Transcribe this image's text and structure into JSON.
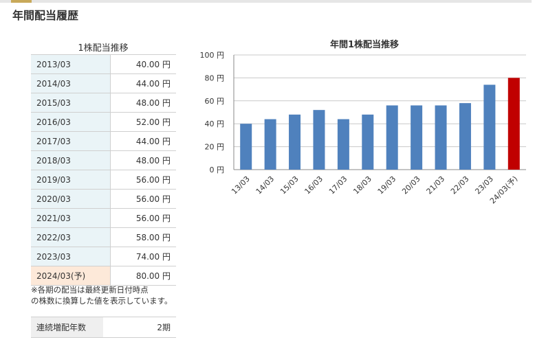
{
  "section_title": "年間配当履歴",
  "table": {
    "caption": "1株配当推移",
    "rows": [
      {
        "year": "2013/03",
        "value": "40.00 円"
      },
      {
        "year": "2014/03",
        "value": "44.00 円"
      },
      {
        "year": "2015/03",
        "value": "48.00 円"
      },
      {
        "year": "2016/03",
        "value": "52.00 円"
      },
      {
        "year": "2017/03",
        "value": "44.00 円"
      },
      {
        "year": "2018/03",
        "value": "48.00 円"
      },
      {
        "year": "2019/03",
        "value": "56.00 円"
      },
      {
        "year": "2020/03",
        "value": "56.00 円"
      },
      {
        "year": "2021/03",
        "value": "56.00 円"
      },
      {
        "year": "2022/03",
        "value": "58.00 円"
      },
      {
        "year": "2023/03",
        "value": "74.00 円"
      },
      {
        "year": "2024/03(予)",
        "value": "80.00 円",
        "forecast": true
      }
    ]
  },
  "note_lines": [
    "※各期の配当は最終更新日付時点",
    "の株数に換算した値を表示しています。"
  ],
  "streak": {
    "label": "連続増配年数",
    "value": "2期"
  },
  "colors": {
    "bar": "#4f81bd",
    "forecast_bar": "#c00000",
    "row_header": "#eaf4f7",
    "forecast_row": "#fde9d9",
    "accent": "#c8a95a"
  },
  "chart_data": {
    "type": "bar",
    "title": "年間1株配当推移",
    "categories": [
      "13/03",
      "14/03",
      "15/03",
      "16/03",
      "17/03",
      "18/03",
      "19/03",
      "20/03",
      "21/03",
      "22/03",
      "23/03",
      "24/03(予)"
    ],
    "values": [
      40,
      44,
      48,
      52,
      44,
      48,
      56,
      56,
      56,
      58,
      74,
      80
    ],
    "forecast_index": 11,
    "ylim": [
      0,
      100
    ],
    "yticks": [
      0,
      20,
      40,
      60,
      80,
      100
    ],
    "ytick_suffix": " 円",
    "grid": true,
    "xlabel": "",
    "ylabel": ""
  }
}
